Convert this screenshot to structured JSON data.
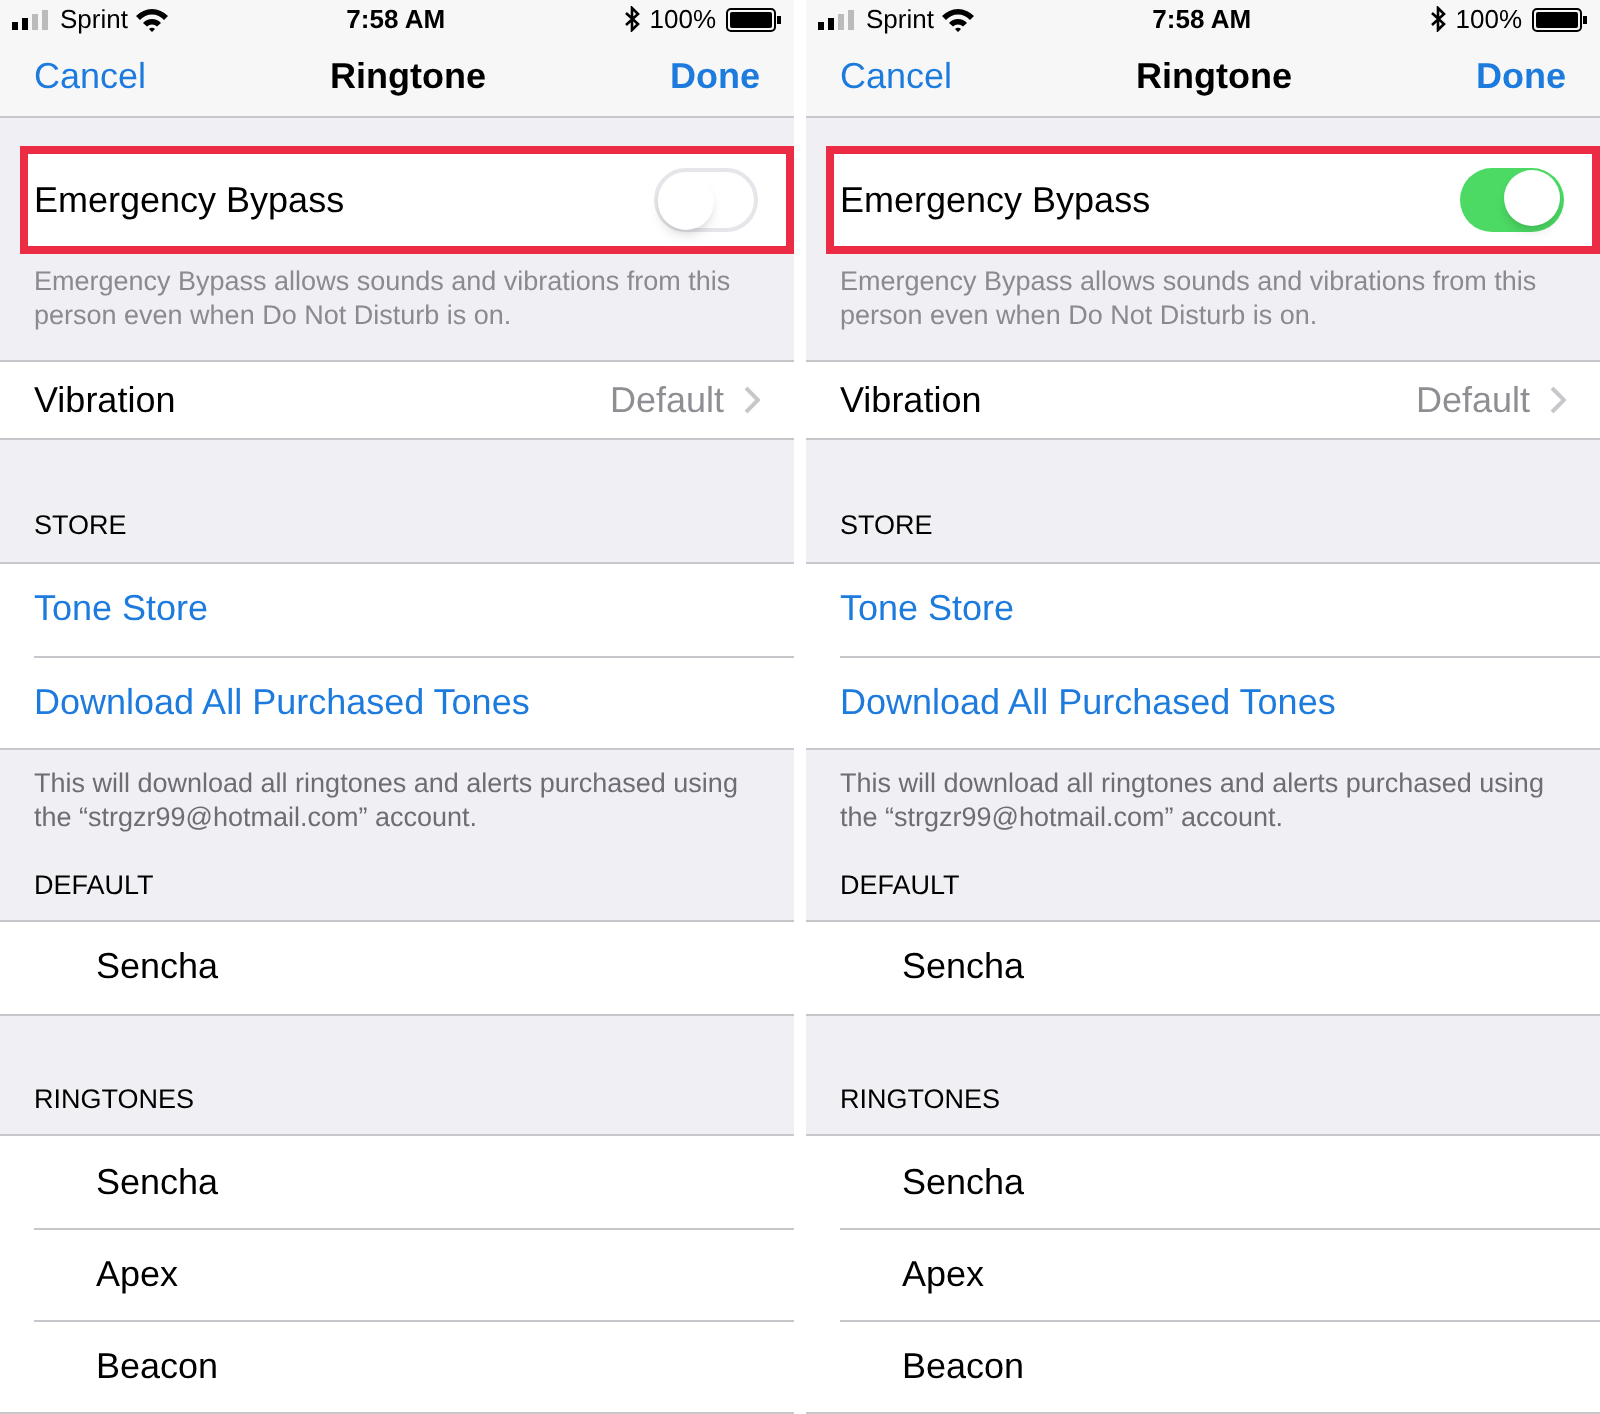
{
  "panels": [
    {
      "status_bar": {
        "carrier": "Sprint",
        "time": "7:58 AM",
        "battery": "100%"
      },
      "nav": {
        "cancel": "Cancel",
        "title": "Ringtone",
        "done": "Done"
      },
      "bypass": {
        "label": "Emergency Bypass",
        "on": false,
        "highlighted": true,
        "footer": "Emergency Bypass allows sounds and vibrations from this person even when Do Not Disturb is on."
      },
      "vibration": {
        "label": "Vibration",
        "value": "Default"
      },
      "store": {
        "header": "STORE",
        "items": [
          "Tone Store",
          "Download All Purchased Tones"
        ],
        "footer": "This will download all ringtones and alerts purchased using the “strgzr99@hotmail.com” account."
      },
      "default": {
        "header": "DEFAULT",
        "items": [
          "Sencha"
        ]
      },
      "ringtones": {
        "header": "RINGTONES",
        "items": [
          "Sencha",
          "Apex",
          "Beacon"
        ]
      }
    },
    {
      "status_bar": {
        "carrier": "Sprint",
        "time": "7:58 AM",
        "battery": "100%"
      },
      "nav": {
        "cancel": "Cancel",
        "title": "Ringtone",
        "done": "Done"
      },
      "bypass": {
        "label": "Emergency Bypass",
        "on": true,
        "highlighted": true,
        "footer": "Emergency Bypass allows sounds and vibrations from this person even when Do Not Disturb is on."
      },
      "vibration": {
        "label": "Vibration",
        "value": "Default"
      },
      "store": {
        "header": "STORE",
        "items": [
          "Tone Store",
          "Download All Purchased Tones"
        ],
        "footer": "This will download all ringtones and alerts purchased using the “strgzr99@hotmail.com” account."
      },
      "default": {
        "header": "DEFAULT",
        "items": [
          "Sencha"
        ]
      },
      "ringtones": {
        "header": "RINGTONES",
        "items": [
          "Sencha",
          "Apex",
          "Beacon"
        ]
      }
    }
  ]
}
